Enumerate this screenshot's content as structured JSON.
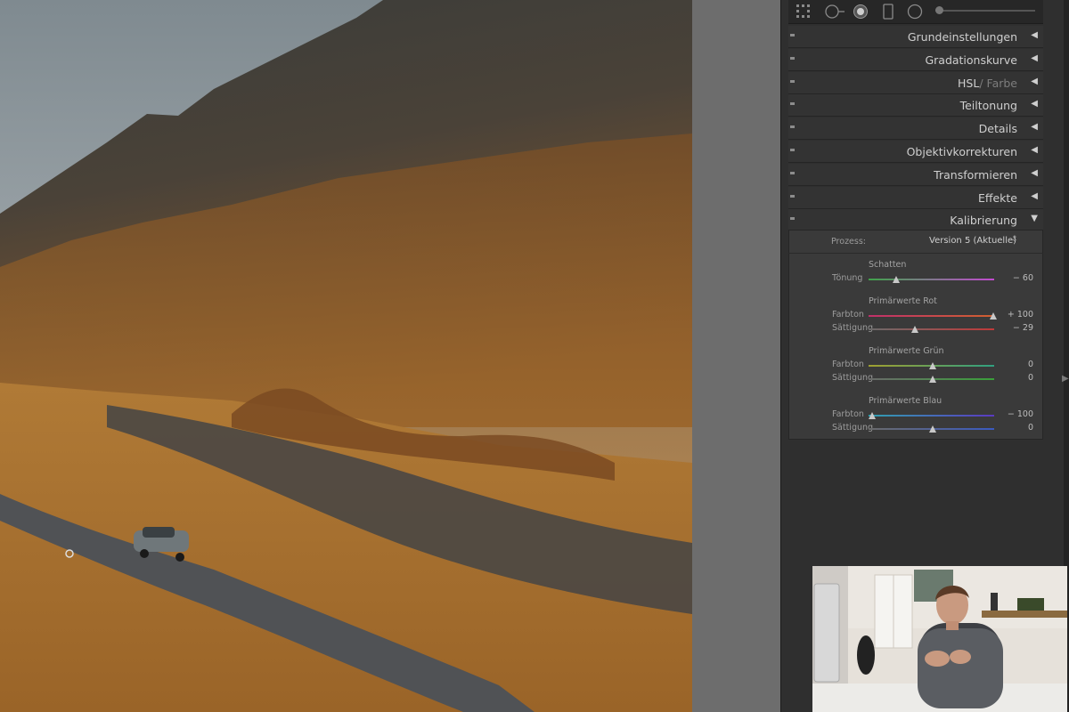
{
  "tools": [
    {
      "icon": "grid-crop-icon"
    },
    {
      "icon": "spot-removal-icon"
    },
    {
      "icon": "redeye-icon"
    },
    {
      "icon": "graduated-filter-icon"
    },
    {
      "icon": "radial-filter-icon"
    }
  ],
  "sections": [
    {
      "name": "grundeinstellungen",
      "label": "Grundeinstellungen",
      "collapsed": true
    },
    {
      "name": "gradationskurve",
      "label": "Gradationskurve",
      "collapsed": true
    },
    {
      "name": "hsl-farbe",
      "label": "HSL",
      "label_suffix": "/ Farbe",
      "collapsed": true
    },
    {
      "name": "teiltonung",
      "label": "Teiltonung",
      "collapsed": true
    },
    {
      "name": "details",
      "label": "Details",
      "collapsed": true
    },
    {
      "name": "objektivkorrekturen",
      "label": "Objektivkorrekturen",
      "collapsed": true
    },
    {
      "name": "transformieren",
      "label": "Transformieren",
      "collapsed": true
    },
    {
      "name": "effekte",
      "label": "Effekte",
      "collapsed": true
    },
    {
      "name": "kalibrierung",
      "label": "Kalibrierung",
      "collapsed": false
    }
  ],
  "arrows": {
    "collapsed": "◀",
    "expanded": "▼"
  },
  "kalibrierung": {
    "process_label": "Prozess:",
    "process_value": "Version 5 (Aktuelle)",
    "process_arrow": "⇕",
    "groups": [
      {
        "title": "Schatten",
        "sliders": [
          {
            "label": "Tönung",
            "value_text": "− 60",
            "value": -60,
            "min": -100,
            "max": 100,
            "gradient": [
              "#3fa34a",
              "#c24ad0"
            ]
          }
        ]
      },
      {
        "title": "Primärwerte Rot",
        "sliders": [
          {
            "label": "Farbton",
            "value_text": "+ 100",
            "value": 100,
            "min": -100,
            "max": 100,
            "gradient": [
              "#c0306a",
              "#d06030"
            ]
          },
          {
            "label": "Sättigung",
            "value_text": "− 29",
            "value": -29,
            "min": -100,
            "max": 100,
            "gradient": [
              "#6a6a6a",
              "#c03a3a"
            ]
          }
        ]
      },
      {
        "title": "Primärwerte Grün",
        "sliders": [
          {
            "label": "Farbton",
            "value_text": "0",
            "value": 0,
            "min": -100,
            "max": 100,
            "gradient": [
              "#a0a030",
              "#30a080"
            ]
          },
          {
            "label": "Sättigung",
            "value_text": "0",
            "value": 0,
            "min": -100,
            "max": 100,
            "gradient": [
              "#6a6a6a",
              "#3aa03a"
            ]
          }
        ]
      },
      {
        "title": "Primärwerte Blau",
        "sliders": [
          {
            "label": "Farbton",
            "value_text": "− 100",
            "value": -100,
            "min": -100,
            "max": 100,
            "gradient": [
              "#30a0b0",
              "#5a3ac0"
            ]
          },
          {
            "label": "Sättigung",
            "value_text": "0",
            "value": 0,
            "min": -100,
            "max": 100,
            "gradient": [
              "#6a6a6a",
              "#3a5ac0"
            ]
          }
        ]
      }
    ]
  },
  "colors": {
    "panel_bg": "#2f2f2f",
    "section_bg": "#333333",
    "gutter": "#6d6d6d",
    "text": "#cfcfcf"
  }
}
